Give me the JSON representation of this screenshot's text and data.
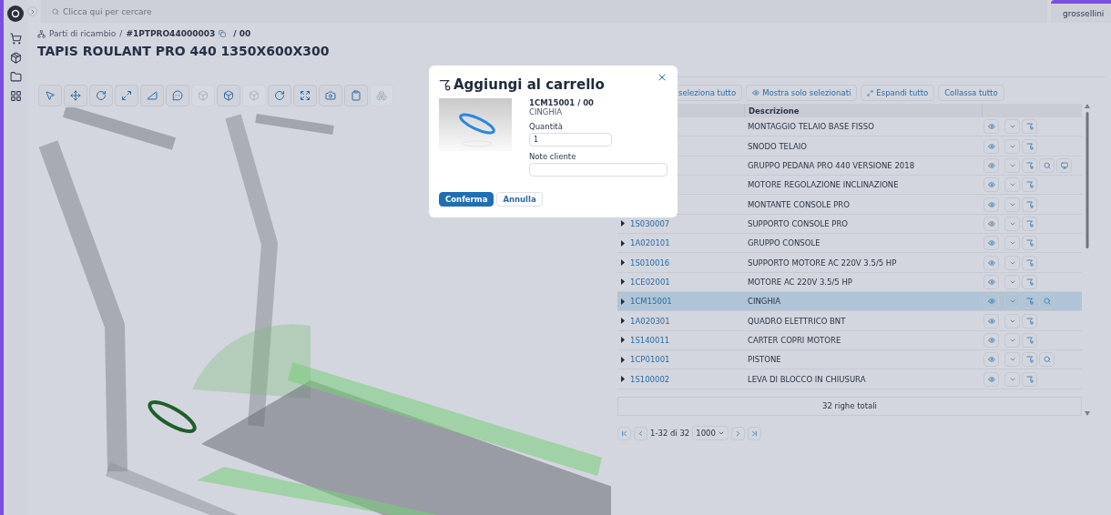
{
  "search": {
    "placeholder": "Clicca qui per cercare"
  },
  "user": {
    "name": "grossellini"
  },
  "breadcrumb": {
    "section": "Parti di ricambio",
    "separator": "/",
    "code": "#1PTPRO44000003",
    "revision": "/ 00"
  },
  "title": "TAPIS ROULANT PRO 440 1350X600X300",
  "toolbar": [
    {
      "kind": "select",
      "disabled": false
    },
    {
      "kind": "move",
      "disabled": false
    },
    {
      "kind": "rotate",
      "disabled": false
    },
    {
      "kind": "scale",
      "disabled": false
    },
    {
      "kind": "measure",
      "disabled": false
    },
    {
      "kind": "comment",
      "disabled": false
    },
    {
      "kind": "cube",
      "disabled": true
    },
    {
      "kind": "cube",
      "disabled": false
    },
    {
      "kind": "cube",
      "disabled": true
    },
    {
      "kind": "reset",
      "disabled": false
    },
    {
      "kind": "fit",
      "disabled": false
    },
    {
      "kind": "camera",
      "disabled": false
    },
    {
      "kind": "clipboard",
      "disabled": false
    },
    {
      "kind": "cubes",
      "disabled": true
    }
  ],
  "table_actions": [
    {
      "kind": "plain",
      "label": "seleziona tutto"
    },
    {
      "kind": "eye",
      "label": "Mostra solo selezionati"
    },
    {
      "kind": "expand",
      "label": "Espandi tutto"
    },
    {
      "kind": "plain",
      "label": "Collassa tutto"
    }
  ],
  "table": {
    "columns": [
      "Descrizione"
    ],
    "rows": [
      {
        "description": "MONTAGGIO TELAIO BASE FISSO",
        "selected": false,
        "zoom": false,
        "screen": false
      },
      {
        "description": "SNODO TELAIO",
        "selected": false,
        "zoom": false,
        "screen": false
      },
      {
        "description": "GRUPPO PEDANA PRO 440 VERSIONE 2018",
        "selected": false,
        "zoom": true,
        "screen": true
      },
      {
        "description": "MOTORE REGOLAZIONE INCLINAZIONE",
        "selected": false,
        "zoom": false,
        "screen": false
      },
      {
        "description": "MONTANTE CONSOLE PRO",
        "selected": false,
        "zoom": false,
        "screen": false
      },
      {
        "code": "1S030007",
        "description": "SUPPORTO CONSOLE PRO",
        "selected": false,
        "zoom": false,
        "screen": false
      },
      {
        "code": "1A020101",
        "description": "GRUPPO CONSOLE",
        "selected": false,
        "zoom": false,
        "screen": false
      },
      {
        "code": "1S010016",
        "description": "SUPPORTO MOTORE AC 220V 3.5/5 HP",
        "selected": false,
        "zoom": false,
        "screen": false
      },
      {
        "code": "1CE02001",
        "description": "MOTORE AC 220V 3.5/5 HP",
        "selected": false,
        "zoom": false,
        "screen": false
      },
      {
        "code": "1CM15001",
        "description": "CINGHIA",
        "selected": true,
        "zoom": true,
        "screen": false
      },
      {
        "code": "1A020301",
        "description": "QUADRO ELETTRICO BNT",
        "selected": false,
        "zoom": false,
        "screen": false
      },
      {
        "code": "1S140011",
        "description": "CARTER COPRI MOTORE",
        "selected": false,
        "zoom": false,
        "screen": false
      },
      {
        "code": "1CP01001",
        "description": "PISTONE",
        "selected": false,
        "zoom": true,
        "screen": false
      },
      {
        "code": "1S100002",
        "description": "LEVA DI BLOCCO IN CHIUSURA",
        "selected": false,
        "zoom": false,
        "screen": false
      }
    ]
  },
  "footer": "32 righe totali",
  "pagination": {
    "range": "1-32 di 32",
    "page_size": "1000"
  },
  "dialog": {
    "title": "Aggiungi al carrello",
    "code": "1CM15001 / 00",
    "name": "CINGHIA",
    "quantity": {
      "label": "Quantità",
      "value": "1"
    },
    "notes": {
      "label": "Note cliente"
    },
    "buttons": [
      {
        "label": "Conferma",
        "primary": true
      },
      {
        "label": "Annulla",
        "primary": false
      }
    ]
  }
}
